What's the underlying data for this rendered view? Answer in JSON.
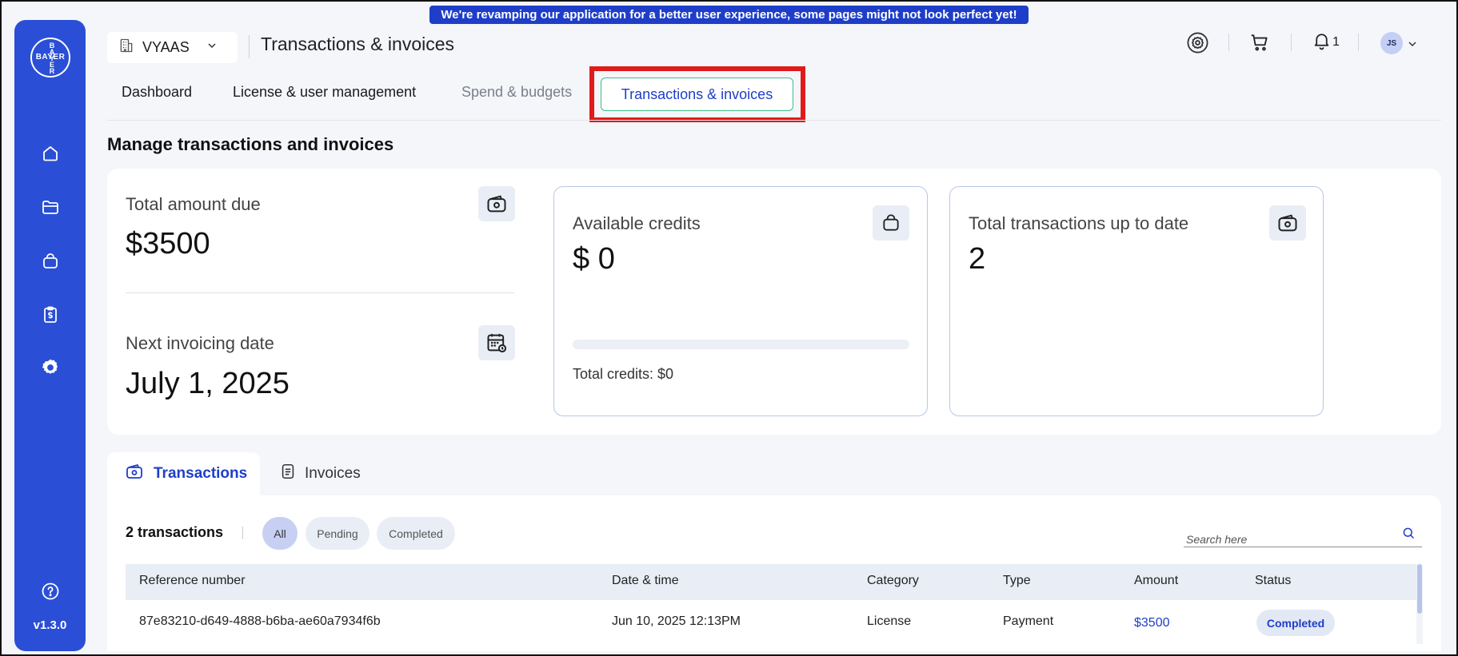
{
  "banner": {
    "text": "We're revamping our application for a better user experience, some pages might not look perfect yet!"
  },
  "sidebar": {
    "logo": {
      "horizontal": "BAYER",
      "vertical": "BAYER"
    },
    "items": [
      {
        "icon": "home-icon"
      },
      {
        "icon": "folder-icon"
      },
      {
        "icon": "bag-icon"
      },
      {
        "icon": "clipboard-dollar-icon"
      },
      {
        "icon": "gear-icon"
      }
    ],
    "help_icon": "help-icon",
    "version": "v1.3.0"
  },
  "header": {
    "org_name": "VYAAS",
    "title": "Transactions & invoices",
    "notification_count": "1",
    "avatar_initials": "JS"
  },
  "tabs": [
    {
      "label": "Dashboard"
    },
    {
      "label": "License & user management"
    },
    {
      "label": "Spend & budgets"
    },
    {
      "label": "Transactions & invoices"
    }
  ],
  "main": {
    "section_title": "Manage transactions and invoices",
    "total_due": {
      "label": "Total amount due",
      "value": "$3500"
    },
    "next_invoice": {
      "label": "Next invoicing date",
      "value": "July 1, 2025"
    },
    "credits": {
      "label": "Available credits",
      "value": "$ 0",
      "total_label": "Total credits: $0",
      "progress": 0
    },
    "transactions_total": {
      "label": "Total transactions up to date",
      "value": "2"
    }
  },
  "subtabs": [
    {
      "label": "Transactions"
    },
    {
      "label": "Invoices"
    }
  ],
  "table": {
    "count_label": "2 transactions",
    "filters": [
      "All",
      "Pending",
      "Completed"
    ],
    "search_placeholder": "Search here",
    "columns": [
      "Reference number",
      "Date & time",
      "Category",
      "Type",
      "Amount",
      "Status"
    ],
    "rows": [
      {
        "reference": "87e83210-d649-4888-b6ba-ae60a7934f6b",
        "datetime": "Jun 10, 2025 12:13PM",
        "category": "License",
        "type": "Payment",
        "amount": "$3500",
        "status": "Completed"
      }
    ]
  },
  "colors": {
    "sidebar": "#2a4fd6",
    "accent": "#1e3ec9",
    "active_tab_border": "#3bbf8a",
    "highlight": "#e01b1b"
  }
}
